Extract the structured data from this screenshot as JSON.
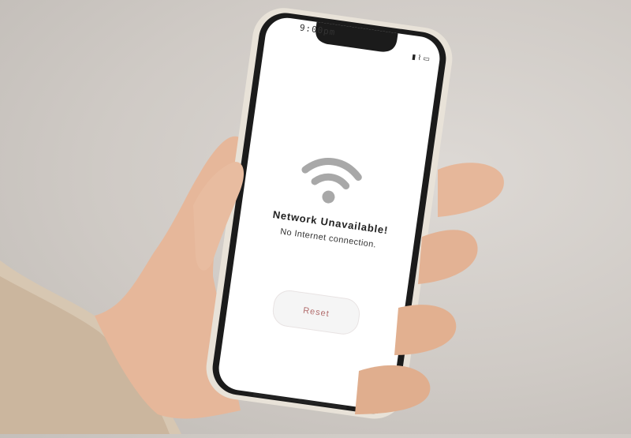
{
  "status_bar": {
    "time": "9:00pm",
    "icons": [
      "signal-icon",
      "wifi-icon",
      "battery-icon"
    ]
  },
  "screen": {
    "wifi_icon": "wifi-icon",
    "title": "Network Unavailable!",
    "subtitle": "No Internet connection.",
    "reset_label": "Reset"
  },
  "colors": {
    "background": "#cfcac5",
    "screen": "#ffffff",
    "phone_frame": "#1b1b1b",
    "phone_rim": "#e8e2d8",
    "wifi_icon": "#a8a8a8",
    "reset_text": "#b26d6d"
  }
}
